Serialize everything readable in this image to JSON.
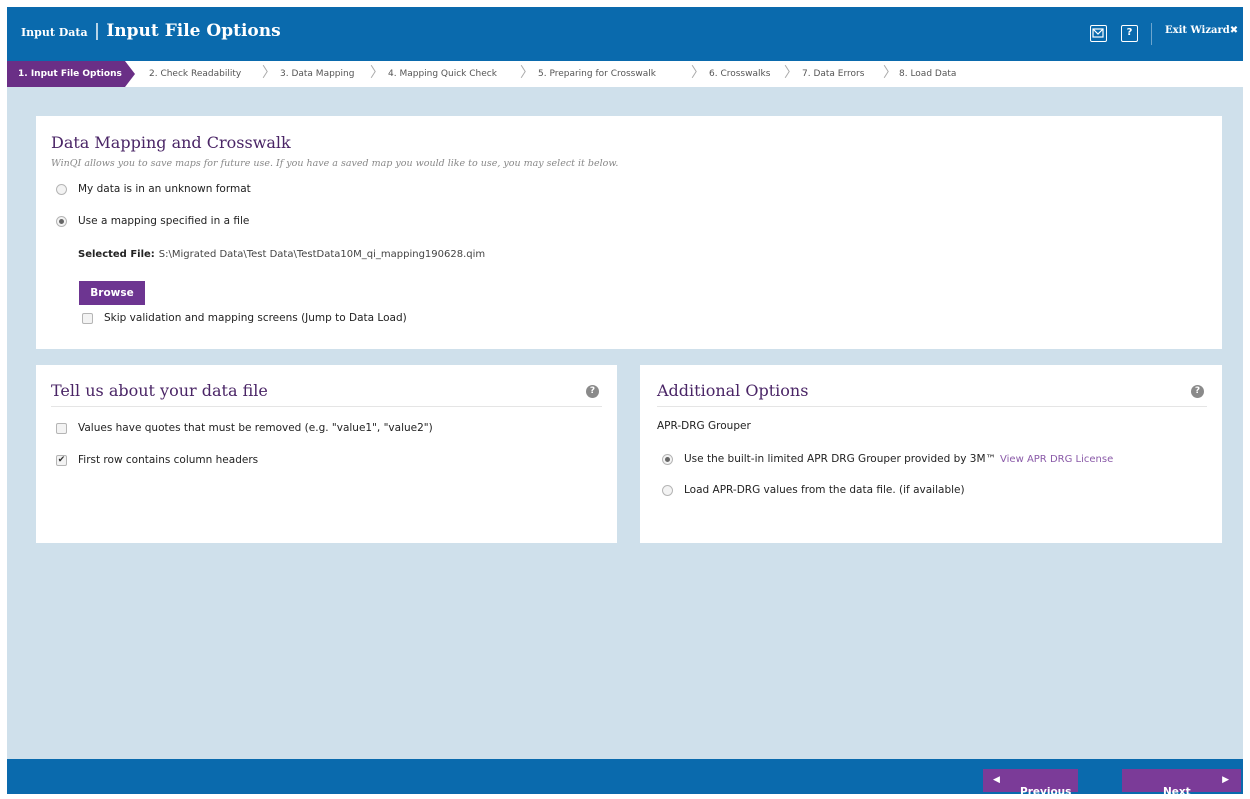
{
  "header": {
    "title_small": "Input Data",
    "title_separator": "|",
    "title_main": "Input File Options",
    "help_label": "?",
    "exit_label": "Exit Wizard",
    "exit_icon": "✖",
    "mail_icon": "mail-icon"
  },
  "steps": [
    "1. Input File Options",
    "2. Check Readability",
    "3. Data Mapping",
    "4. Mapping Quick Check",
    "5. Preparing for Crosswalk",
    "6. Crosswalks",
    "7. Data Errors",
    "8. Load Data"
  ],
  "mapping_panel": {
    "title": "Data Mapping and Crosswalk",
    "subtitle": "WinQI allows you to save maps for future use. If you have a saved map you would like to use, you may select it below.",
    "option_unknown": "My data is in an unknown format",
    "option_file": "Use a mapping specified in a file",
    "selected_file_label": "Selected File:",
    "selected_file_value": "S:\\Migrated Data\\Test Data\\TestData10M_qi_mapping190628.qim",
    "browse_label": "Browse",
    "skip_label": "Skip validation and mapping screens (Jump to Data Load)"
  },
  "datafile_panel": {
    "title": "Tell us about your data file",
    "help": "?",
    "quotes_label": "Values have quotes that must be removed (e.g. \"value1\", \"value2\")",
    "headers_label": "First row contains column headers",
    "check_mark": "✔"
  },
  "options_panel": {
    "title": "Additional Options",
    "help": "?",
    "grouper_label": "APR-DRG Grouper",
    "builtin_label": "Use the built-in limited APR DRG Grouper provided by 3M™",
    "license_link": "View APR DRG License",
    "load_label": "Load APR-DRG values from the data file. (if available)"
  },
  "footer": {
    "previous_label": "Previous",
    "next_label": "Next",
    "prev_arrow": "◀",
    "next_arrow": "▶"
  },
  "colors": {
    "header_blue": "#0a6aad",
    "accent_purple": "#6a2f86",
    "background": "#cfe0eb"
  }
}
